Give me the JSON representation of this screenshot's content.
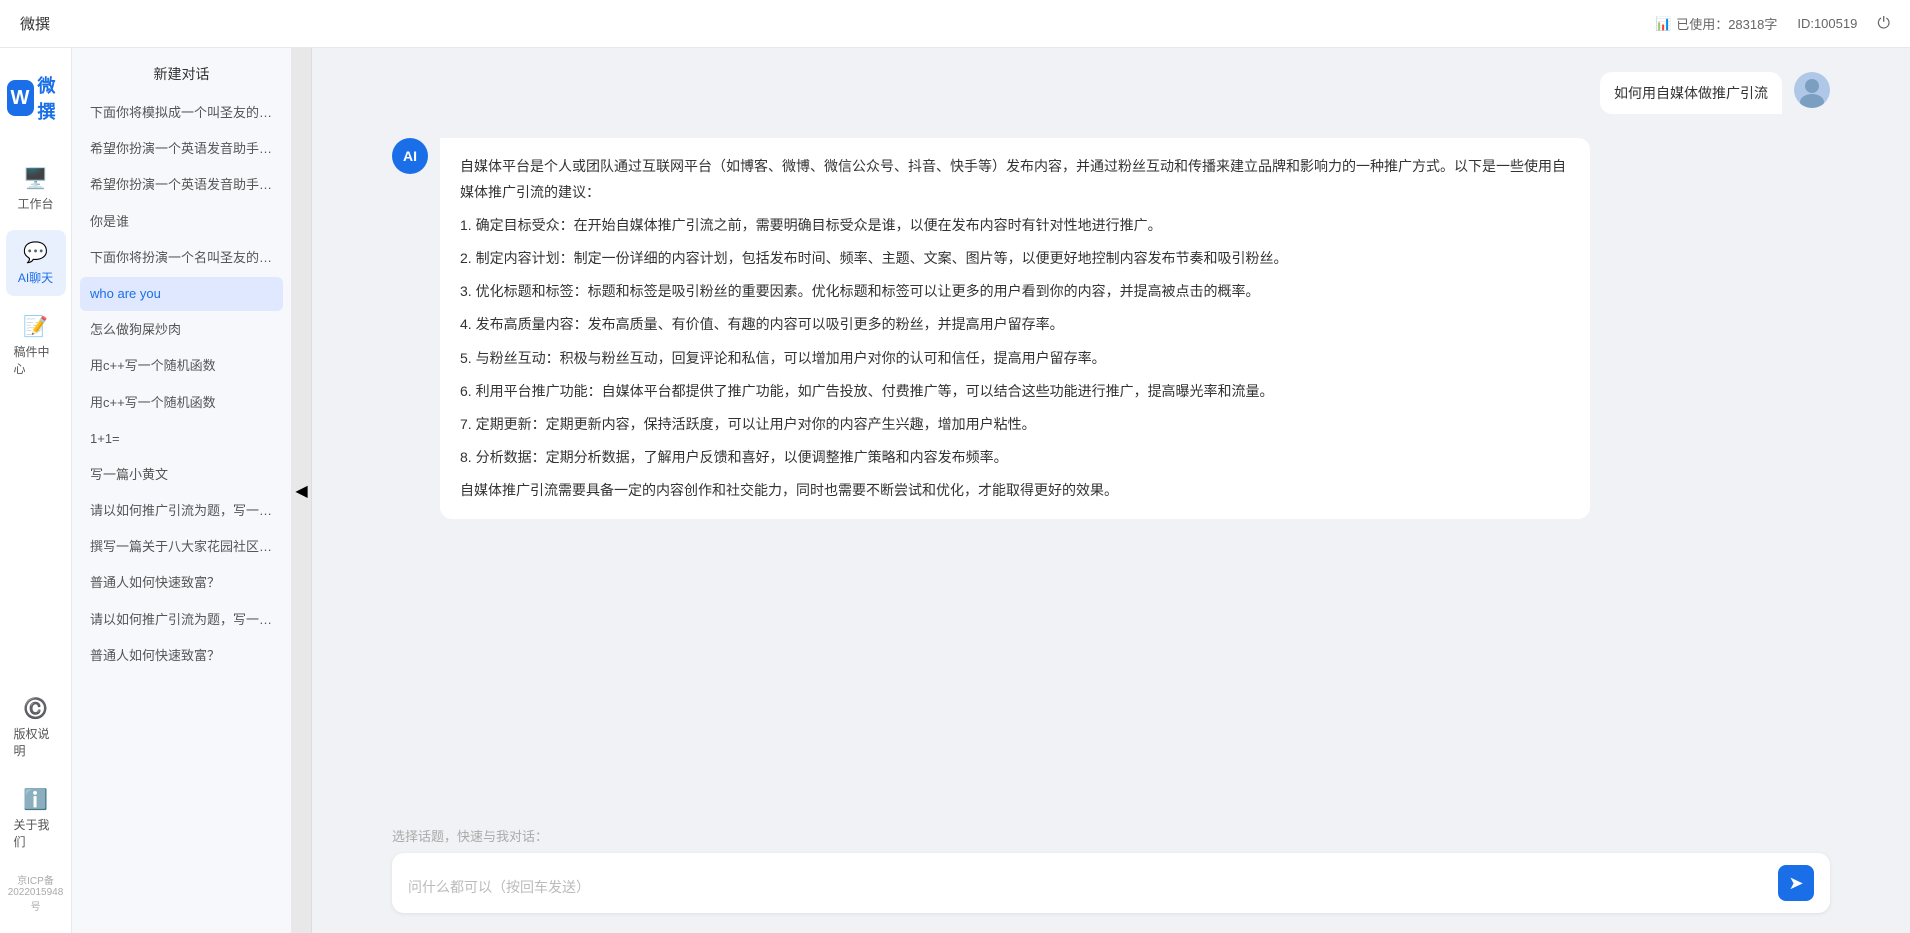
{
  "app": {
    "name": "微撰",
    "logo_letter": "W",
    "usage_label": "已使用：28318字",
    "id_label": "ID:100519"
  },
  "nav": {
    "items": [
      {
        "id": "workbench",
        "icon": "🖥️",
        "label": "工作台"
      },
      {
        "id": "ai-chat",
        "icon": "💬",
        "label": "AI聊天",
        "active": true
      },
      {
        "id": "drafts",
        "icon": "📝",
        "label": "稿件中心"
      }
    ],
    "bottom_items": [
      {
        "id": "copyright",
        "icon": "©️",
        "label": "版权说明"
      },
      {
        "id": "about",
        "icon": "ℹ️",
        "label": "关于我们"
      }
    ],
    "icp": "京ICP备2022015948号"
  },
  "sidebar": {
    "new_chat": "新建对话",
    "conversations": [
      {
        "id": 1,
        "text": "下面你将模拟成一个叫圣友的程序员，我说..."
      },
      {
        "id": 2,
        "text": "希望你扮演一个英语发音助手，我提供给你..."
      },
      {
        "id": 3,
        "text": "希望你扮演一个英语发音助手，我提供给你..."
      },
      {
        "id": 4,
        "text": "你是谁"
      },
      {
        "id": 5,
        "text": "下面你将扮演一个名叫圣友的医生"
      },
      {
        "id": 6,
        "text": "who are you",
        "active": true
      },
      {
        "id": 7,
        "text": "怎么做狗屎炒肉"
      },
      {
        "id": 8,
        "text": "用c++写一个随机函数"
      },
      {
        "id": 9,
        "text": "用c++写一个随机函数"
      },
      {
        "id": 10,
        "text": "1+1="
      },
      {
        "id": 11,
        "text": "写一篇小黄文"
      },
      {
        "id": 12,
        "text": "请以如何推广引流为题，写一篇大纲"
      },
      {
        "id": 13,
        "text": "撰写一篇关于八大家花园社区一刻钟便民生..."
      },
      {
        "id": 14,
        "text": "普通人如何快速致富？"
      },
      {
        "id": 15,
        "text": "请以如何推广引流为题，写一篇大纲"
      },
      {
        "id": 16,
        "text": "普通人如何快速致富？"
      }
    ]
  },
  "chat": {
    "user_question": "如何用自媒体做推广引流",
    "ai_response": {
      "paragraphs": [
        "自媒体平台是个人或团队通过互联网平台（如博客、微博、微信公众号、抖音、快手等）发布内容，并通过粉丝互动和传播来建立品牌和影响力的一种推广方式。以下是一些使用自媒体推广引流的建议：",
        "1. 确定目标受众：在开始自媒体推广引流之前，需要明确目标受众是谁，以便在发布内容时有针对性地进行推广。",
        "2. 制定内容计划：制定一份详细的内容计划，包括发布时间、频率、主题、文案、图片等，以便更好地控制内容发布节奏和吸引粉丝。",
        "3. 优化标题和标签：标题和标签是吸引粉丝的重要因素。优化标题和标签可以让更多的用户看到你的内容，并提高被点击的概率。",
        "4. 发布高质量内容：发布高质量、有价值、有趣的内容可以吸引更多的粉丝，并提高用户留存率。",
        "5. 与粉丝互动：积极与粉丝互动，回复评论和私信，可以增加用户对你的认可和信任，提高用户留存率。",
        "6. 利用平台推广功能：自媒体平台都提供了推广功能，如广告投放、付费推广等，可以结合这些功能进行推广，提高曝光率和流量。",
        "7. 定期更新：定期更新内容，保持活跃度，可以让用户对你的内容产生兴趣，增加用户粘性。",
        "8. 分析数据：定期分析数据，了解用户反馈和喜好，以便调整推广策略和内容发布频率。",
        "自媒体推广引流需要具备一定的内容创作和社交能力，同时也需要不断尝试和优化，才能取得更好的效果。"
      ]
    },
    "quick_label": "选择话题，快速与我对话：",
    "input_placeholder": "问什么都可以（按回车发送）"
  },
  "icons": {
    "send": "➤",
    "collapse": "◀",
    "usage_icon": "📊",
    "power_icon": "⏻"
  }
}
